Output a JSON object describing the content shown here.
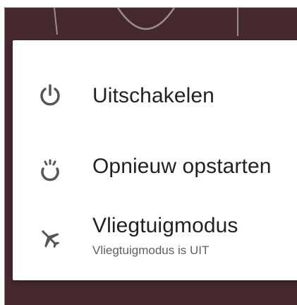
{
  "power_menu": {
    "items": [
      {
        "label": "Uitschakelen",
        "icon": "power-icon"
      },
      {
        "label": "Opnieuw opstarten",
        "icon": "restart-icon"
      },
      {
        "label": "Vliegtuigmodus",
        "sublabel": "Vliegtuigmodus is UIT",
        "icon": "airplane-icon"
      }
    ]
  },
  "colors": {
    "background": "#45292f",
    "dialog": "#ffffff",
    "text_primary": "#222222",
    "text_secondary": "#5f5f5f",
    "icon": "#555555"
  }
}
